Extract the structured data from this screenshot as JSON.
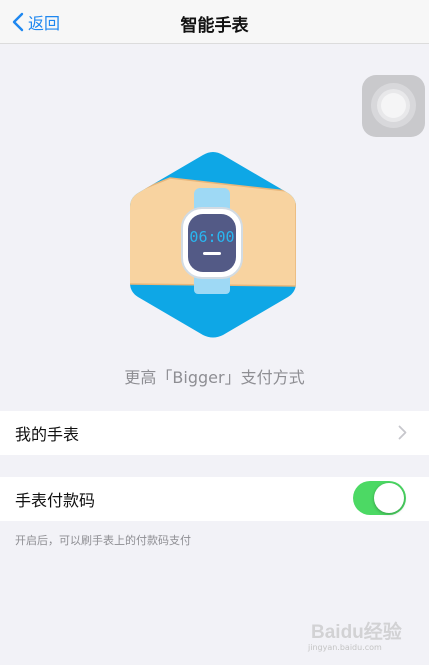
{
  "navbar": {
    "back_label": "返回",
    "title": "智能手表"
  },
  "hero": {
    "watch_time": "06:00"
  },
  "caption": "更高「Bigger」支付方式",
  "rows": {
    "my_watch": {
      "label": "我的手表"
    },
    "watch_payment": {
      "label": "手表付款码",
      "enabled": true
    }
  },
  "footnote": "开启后，可以刷手表上的付款码支付",
  "watermark": {
    "brand": "Baidu经验",
    "domain": "jingyan.baidu.com"
  },
  "colors": {
    "accent": "#1e87f0",
    "toggle_on": "#4cd964",
    "hexagon": "#0ea7e6",
    "watch_face": "#535a86",
    "watch_time": "#2ab6f0",
    "band": "#9ed9f5",
    "arm": "#f8d3a0"
  }
}
